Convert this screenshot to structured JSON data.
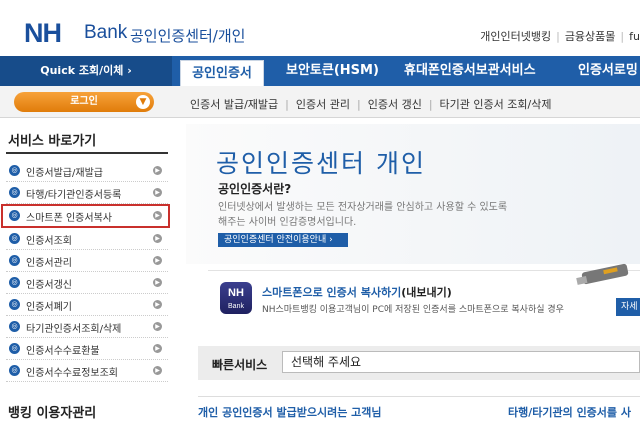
{
  "header": {
    "logo_nh": "NH",
    "logo_bank": "Bank",
    "title": "공인인증센터/개인",
    "links": [
      "개인인터넷뱅킹",
      "금융상품몰",
      "fu"
    ]
  },
  "nav": {
    "quick": "Quick 조회/이체 ›",
    "tabs": [
      "공인인증서",
      "보안토큰(HSM)",
      "휴대폰인증서보관서비스",
      "인증서로밍"
    ]
  },
  "subnav": {
    "login": "로그인",
    "links": [
      "인증서 발급/재발급",
      "인증서 관리",
      "인증서 갱신",
      "타기관 인증서 조회/삭제"
    ]
  },
  "sidebar": {
    "title": "서비스 바로가기",
    "items": [
      "인증서발급/재발급",
      "타행/타기관인증서등록",
      "스마트폰 인증서복사",
      "인증서조회",
      "인증서관리",
      "인증서갱신",
      "인증서폐기",
      "타기관인증서조회/삭제",
      "인증서수수료환불",
      "인증서수수료정보조회"
    ],
    "title2": "뱅킹 이용자관리"
  },
  "hero": {
    "title": "공인인증센터 개인",
    "question": "공인인증서란?",
    "desc1": "인터넷상에서 발생하는 모든 전자상거래를 안심하고 사용할 수 있도록",
    "desc2": "해주는 사이버 인감증명서입니다.",
    "button": "공인인증센터 안전이용안내 ›"
  },
  "phone": {
    "icon_line1": "NH",
    "icon_line2": "Bank",
    "title_main": "스마트폰으로 인증서 복사하기",
    "title_sub": "(내보내기)",
    "desc": "NH스마트뱅킹 이용고객님이 PC에 저장된 인증서를 스마트폰으로 복사하실 경우",
    "button": "자세"
  },
  "quick_service": {
    "label": "빠른서비스",
    "select_value": "선택해 주세요"
  },
  "bottom": {
    "left": "개인 공인인증서 발급받으시려는 고객님",
    "right": "타행/타기관의 인증서를 사"
  }
}
